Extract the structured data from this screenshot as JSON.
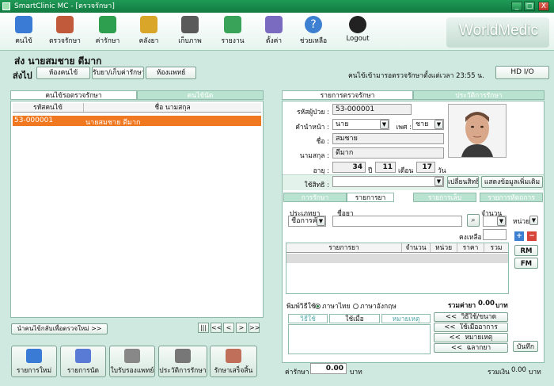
{
  "window": {
    "title": "SmartClinic MC - [ตรวจรักษา]",
    "min": "_",
    "max": "□",
    "close": "X"
  },
  "toolbar": {
    "items": [
      {
        "label": "คนไข้",
        "color": "#3a7bd5"
      },
      {
        "label": "ตรวจรักษา",
        "color": "#c05a3a"
      },
      {
        "label": "ค่ารักษา",
        "color": "#2e9e4f"
      },
      {
        "label": "คลังยา",
        "color": "#d9a62a"
      },
      {
        "label": "เก็บภาพ",
        "color": "#5a5a5a"
      },
      {
        "label": "รายงาน",
        "color": "#3aa35a"
      },
      {
        "label": "ตั้งค่า",
        "color": "#7a6ac0"
      },
      {
        "label": "ช่วยเหลือ",
        "color": "#3d7fd1"
      },
      {
        "label": "Logout",
        "color": "#222222"
      }
    ],
    "logo": "WorldMedic"
  },
  "patient_header": "ส่ง  นายสมชาย ดีมาก",
  "nav": {
    "label": "ส่งไป",
    "buttons": [
      "ห้องคนไข้",
      "รับยา/เก็บค่ารักษา",
      "ห้องแพทย์"
    ],
    "status": "คนไข้เข้ามารอตรวจรักษาตั้งแต่เวลา 23:55 น.",
    "hdio": "HD I/O"
  },
  "left": {
    "tabs": [
      "คนไข้รอตรวจรักษา",
      "คนไข้นัด"
    ],
    "headers": [
      "รหัสคนไข้",
      "ชื่อ นามสกุล"
    ],
    "rows": [
      {
        "code": "53-000001",
        "name": "นายสมชาย ดีมาก"
      }
    ],
    "bring_back": "นำคนไข้กลับเพื่อตรวจใหม่ >>",
    "pager": [
      "|||",
      "<<",
      "<",
      ">",
      ">>"
    ],
    "actions": [
      {
        "label": "รายการใหม่",
        "color": "#3a7bd5"
      },
      {
        "label": "รายการนัด",
        "color": "#5a7bd5"
      },
      {
        "label": "ใบรับรองแพทย์",
        "color": "#888888"
      },
      {
        "label": "ประวัติการรักษา",
        "color": "#777777"
      },
      {
        "label": "รักษาเสร็จสิ้น",
        "color": "#c0705a"
      }
    ]
  },
  "right": {
    "tabs": [
      "รายการตรวจรักษา",
      "ประวัติการรักษา"
    ],
    "form": {
      "patient_id_label": "รหัสผู้ป่วย :",
      "patient_id": "53-000001",
      "prefix_label": "คำนำหน้า :",
      "prefix": "นาย",
      "sex_label": "เพศ :",
      "sex": "ชาย",
      "firstname_label": "ชื่อ :",
      "firstname": "สมชาย",
      "lastname_label": "นามสกุล :",
      "lastname": "ดีมาก",
      "age_label": "อายุ :",
      "age_years": "34",
      "years_unit": "ปี",
      "age_months": "11",
      "months_unit": "เดือน",
      "age_days": "17",
      "days_unit": "วัน",
      "rights_label": "ใช้สิทธิ :",
      "rights_value": "",
      "change_rights": "เปลี่ยนสิทธิ",
      "more_info": "แสดงข้อมูลเพิ่มเติม"
    },
    "subtabs": [
      "การรักษา",
      "รายการยา",
      "รายการเล็บ",
      "รายการหัตถการ"
    ],
    "med": {
      "type_label": "ประเภทยา",
      "type_value": "ชื่อการค้า",
      "name_label": "ชื่อยา",
      "qty_label": "จำนวน",
      "unit_value": "หน่วย",
      "remain_label": "คงเหลือ",
      "headers": [
        "รายการยา",
        "จำนวน",
        "หน่วย",
        "ราคา",
        "รวม"
      ],
      "rm": "RM",
      "fm": "FM",
      "print_label": "พิมพ์วิธีใช้",
      "thai": "ภาษาไทย",
      "english": "ภาษาอังกฤษ",
      "total_label": "รวมค่ายา",
      "total_value": "0.00",
      "currency": "บาท"
    },
    "usage": {
      "tabs": [
        "วิธีใช้",
        "ใช้เมื่อ",
        "หมายเหตุ"
      ],
      "buttons": [
        {
          "arrow": "<<",
          "label": "วิธีใช้/ขนาด"
        },
        {
          "arrow": "<<",
          "label": "ใช้เมื่ออาการ"
        },
        {
          "arrow": "<<",
          "label": "หมายเหตุ"
        },
        {
          "arrow": "<<",
          "label": "ฉลากยา"
        }
      ],
      "save": "บันทึก"
    },
    "footer": {
      "fee_label": "ค่ารักษา :",
      "fee_value": "0.00",
      "fee_unit": "บาท",
      "grand_label": "รวมเงิน",
      "grand_value": "0.00",
      "grand_unit": "บาท"
    }
  }
}
